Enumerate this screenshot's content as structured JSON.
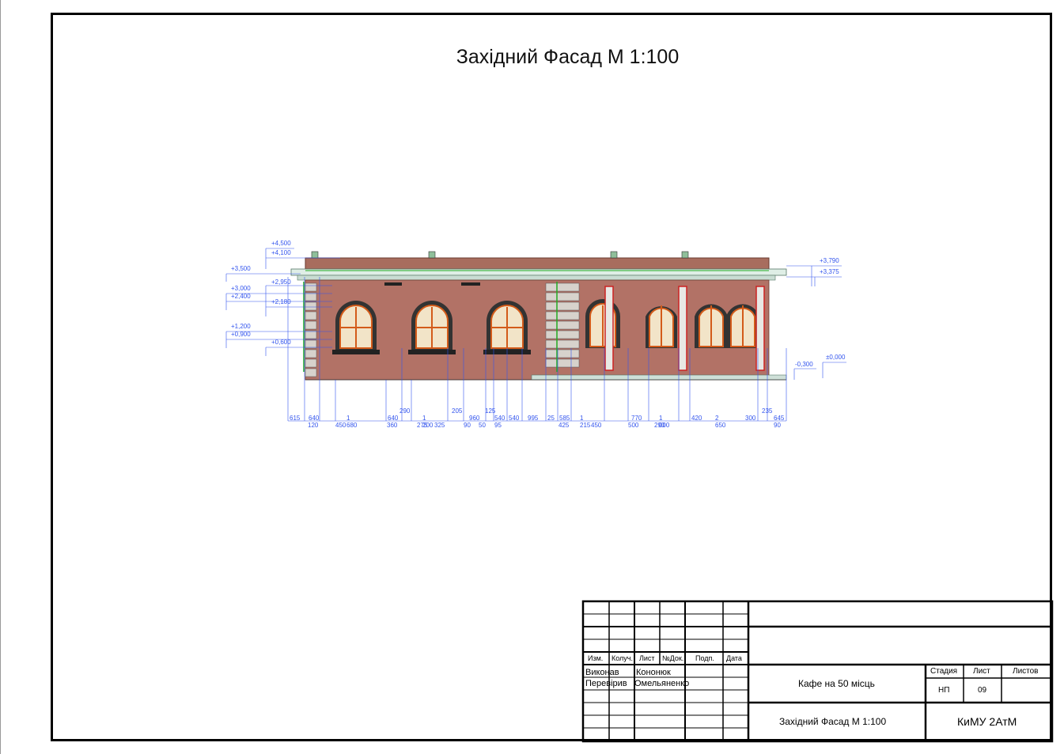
{
  "sheet": {
    "title": "Західний Фасад М 1:100"
  },
  "levels_left": [
    "+4,500",
    "+4,100",
    "+3,500",
    "+2,950",
    "+3,000",
    "+2,400",
    "+2,180",
    "+1,200",
    "+0,900",
    "+0,600"
  ],
  "levels_right": [
    "+3,790",
    "+3,375",
    "-0,300",
    "±0,000"
  ],
  "dims_row1": [
    "615",
    "640",
    "1 680",
    "640",
    "1 200",
    "960",
    "540",
    "540",
    "995",
    "25",
    "585",
    "1 215",
    "770",
    "1 000",
    "420",
    "2 650",
    "300",
    "645"
  ],
  "dims_row2": [
    "120",
    "450",
    "360",
    "275",
    "325",
    "90",
    "50",
    "95",
    "425",
    "450",
    "500",
    "290",
    "90"
  ],
  "dims_row0": [
    "290",
    "205",
    "125",
    "235"
  ],
  "title_block": {
    "headers": [
      "Изм.",
      "Колуч.",
      "Лист",
      "№Док.",
      "Подп.",
      "Дата"
    ],
    "roles": [
      "Виконав",
      "Перевірив"
    ],
    "names": [
      "Кононюк",
      "Омельяненко"
    ],
    "project": "Кафе на 50 місць",
    "sheet_name": "Західний Фасад М 1:100",
    "stage_label": "Стадия",
    "sheet_label": "Лист",
    "sheets_label": "Листов",
    "stage_value": "НП",
    "sheet_value": "09",
    "org": "КиМУ 2АтМ"
  },
  "colors": {
    "wall": "#b27266",
    "roof": "#a86d5e",
    "dim": "#3355ee",
    "trim": "#cc2222",
    "green": "#22aa22"
  }
}
